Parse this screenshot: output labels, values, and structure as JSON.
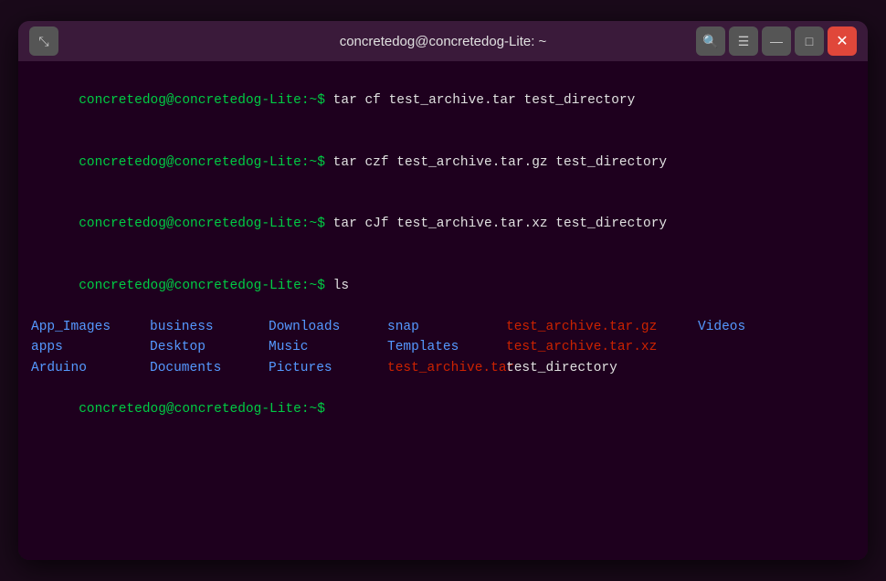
{
  "window": {
    "title": "concretedog@concretedog-Lite: ~",
    "new_tab_icon": "⊞"
  },
  "titlebar": {
    "search_icon": "🔍",
    "menu_icon": "☰",
    "minimize_icon": "—",
    "maximize_icon": "□",
    "close_icon": "✕"
  },
  "terminal": {
    "lines": [
      {
        "prompt": "concretedog@concretedog-Lite:~$ ",
        "command": "tar cf test_archive.tar test_directory"
      },
      {
        "prompt": "concretedog@concretedog-Lite:~$ ",
        "command": "tar czf test_archive.tar.gz test_directory"
      },
      {
        "prompt": "concretedog@concretedog-Lite:~$ ",
        "command": "tar cJf test_archive.tar.xz test_directory"
      },
      {
        "prompt": "concretedog@concretedog-Lite:~$ ",
        "command": "ls"
      }
    ],
    "ls_output": {
      "col1": [
        "App_Images",
        "apps",
        "Arduino",
        ""
      ],
      "col2": [
        "business",
        "Desktop",
        "Documents",
        ""
      ],
      "col3": [
        "Downloads",
        "Music",
        "Pictures",
        ""
      ],
      "col4": [
        "snap",
        "Templates",
        "test_archive.tar",
        ""
      ],
      "col5": [
        "test_archive.tar.gz",
        "test_archive.tar.xz",
        "test_directory",
        ""
      ],
      "col6": [
        "Videos",
        "",
        "",
        ""
      ]
    },
    "final_prompt": "concretedog@concretedog-Lite:~$ "
  }
}
